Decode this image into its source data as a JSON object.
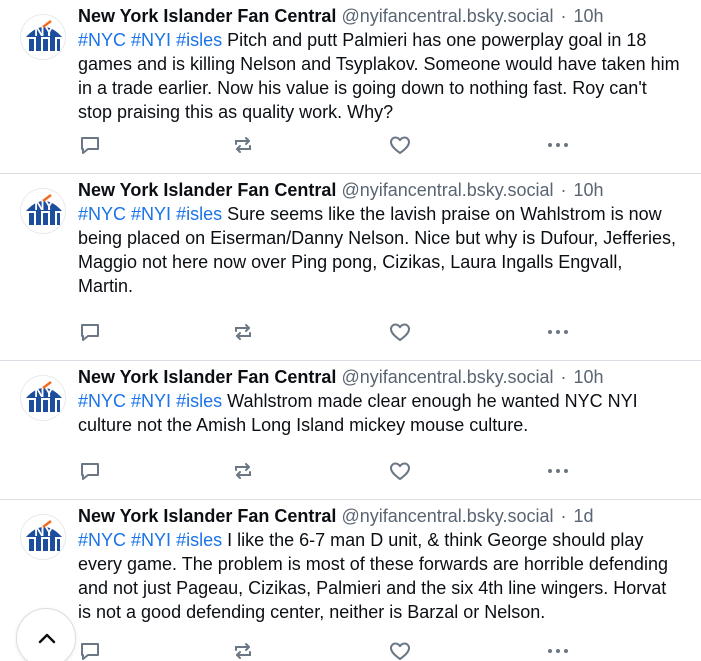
{
  "posts": [
    {
      "display_name": "New York Islander Fan Central",
      "handle": "@nyifancentral.bsky.social",
      "separator": "·",
      "time": "10h",
      "tags": [
        "#NYC",
        "#NYI",
        "#isles"
      ],
      "body": "Pitch and putt Palmieri has one powerplay goal in 18 games and is killing Nelson and Tsyplakov. Someone would have taken him in a trade earlier. Now his value is going down to nothing fast. Roy can't stop praising this as quality work. Why?"
    },
    {
      "display_name": "New York Islander Fan Central",
      "handle": "@nyifancentral.bsky.social",
      "separator": "·",
      "time": "10h",
      "tags": [
        "#NYC",
        "#NYI",
        "#isles"
      ],
      "body": "Sure seems like the lavish praise on Wahlstrom is now being placed on Eiserman/Danny Nelson. Nice but why is Dufour, Jefferies, Maggio not here now over Ping pong, Cizikas, Laura Ingalls Engvall, Martin."
    },
    {
      "display_name": "New York Islander Fan Central",
      "handle": "@nyifancentral.bsky.social",
      "separator": "·",
      "time": "10h",
      "tags": [
        "#NYC",
        "#NYI",
        "#isles"
      ],
      "body": "Wahlstrom made clear enough he wanted NYC NYI culture not the Amish Long Island mickey mouse culture."
    },
    {
      "display_name": "New York Islander Fan Central",
      "handle": "@nyifancentral.bsky.social",
      "separator": "·",
      "time": "1d",
      "tags": [
        "#NYC",
        "#NYI",
        "#isles"
      ],
      "body": "I like the 6-7 man D unit, & think George should play every game. The problem is most of these forwards are horrible defending and not just Pageau, Cizikas, Palmieri and the six 4th line wingers. Horvat is not a good defending center, neither is Barzal or Nelson."
    }
  ],
  "icons": {
    "reply": "speech-bubble-icon",
    "repost": "repost-arrows-icon",
    "like": "heart-outline-icon",
    "more": "ellipsis-icon",
    "scroll_top": "chevron-up-icon",
    "avatar": "nyi-logo-avatar"
  },
  "colors": {
    "hashtag": "#1a73e8",
    "muted": "#5a6573",
    "icon": "#6b7785",
    "divider": "#d9dee4",
    "text": "#0b0f14",
    "logo_blue": "#1d4e9e",
    "logo_orange": "#f26b21"
  }
}
